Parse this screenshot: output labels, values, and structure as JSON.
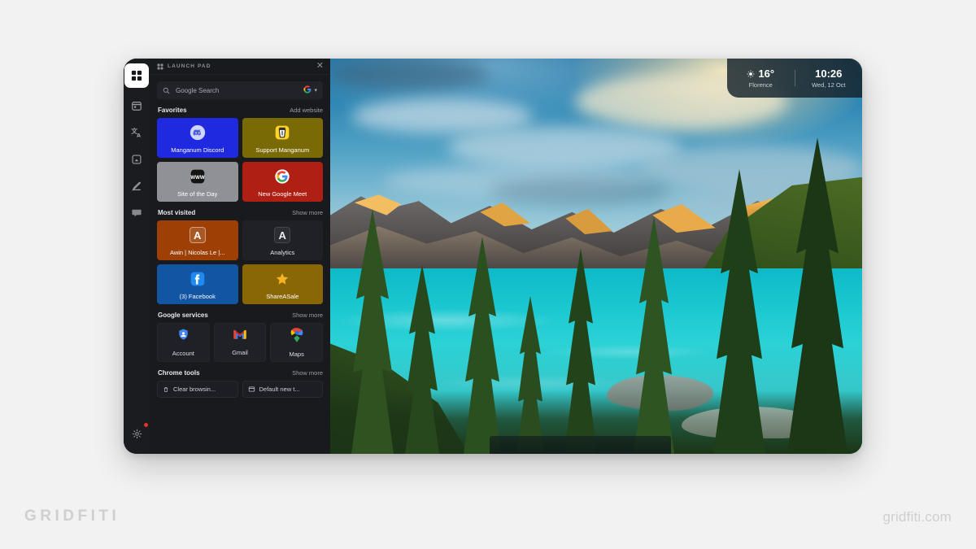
{
  "brand": {
    "left": "GRIDFITI",
    "right": "gridfiti.com"
  },
  "colors": {
    "panel_bg": "#191a1e",
    "rail_bg": "#1b1c20",
    "accent_red": "#e8322b",
    "tile_discord": "#1f2ae0",
    "tile_support": "#7a6a05",
    "tile_siteofday": "#8f9196",
    "tile_meet": "#b01f14",
    "tile_awin": "#9e4005",
    "tile_analytics": "#202127",
    "tile_facebook": "#1155a3",
    "tile_shareasale": "#8a6706"
  },
  "rail": {
    "items": [
      {
        "name": "launchpad",
        "icon": "grid-icon",
        "active": true
      },
      {
        "name": "calendar",
        "icon": "calendar-icon",
        "active": false
      },
      {
        "name": "translate",
        "icon": "translate-icon",
        "active": false
      },
      {
        "name": "screenshot",
        "icon": "screenshot-icon",
        "active": false
      },
      {
        "name": "notes",
        "icon": "edit-note-icon",
        "active": false
      },
      {
        "name": "chat",
        "icon": "chat-bubble-icon",
        "active": false
      }
    ],
    "settings": {
      "name": "settings",
      "icon": "gear-icon",
      "badge": true
    }
  },
  "panel": {
    "title": "LAUNCH PAD",
    "title_icon": "grid-icon",
    "close_label": "✕",
    "search": {
      "placeholder": "Google Search",
      "icon": "search-icon",
      "engine": "Google",
      "chevron": "▾"
    },
    "sections": [
      {
        "id": "favorites",
        "title": "Favorites",
        "action": "Add website",
        "layout": "tiles",
        "tiles": [
          {
            "label": "Manganum Discord",
            "color": "#1f2ae0",
            "icon": "discord-icon",
            "dark": false
          },
          {
            "label": "Support Manganum",
            "color": "#7a6a05",
            "icon": "tip-jar-icon",
            "dark": false
          },
          {
            "label": "Site of the Day",
            "color": "#8f9196",
            "icon": "www-icon",
            "dark": false
          },
          {
            "label": "New Google Meet",
            "color": "#b01f14",
            "icon": "google-icon",
            "dark": false
          }
        ]
      },
      {
        "id": "most-visited",
        "title": "Most visited",
        "action": "Show more",
        "layout": "tiles",
        "tiles": [
          {
            "label": "Awin | Nicolas Le |...",
            "color": "#9e4005",
            "icon": "letter-a-icon",
            "letter": "A",
            "dark": false
          },
          {
            "label": "Analytics",
            "color": "#202127",
            "icon": "letter-a-icon",
            "letter": "A",
            "dark": true
          },
          {
            "label": "(3) Facebook",
            "color": "#1155a3",
            "icon": "facebook-icon",
            "dark": false
          },
          {
            "label": "ShareASale",
            "color": "#8a6706",
            "icon": "star-icon",
            "dark": false
          }
        ]
      },
      {
        "id": "google-services",
        "title": "Google services",
        "action": "Show more",
        "layout": "services",
        "services": [
          {
            "label": "Account",
            "icon": "google-account-shield-icon"
          },
          {
            "label": "Gmail",
            "icon": "gmail-icon"
          },
          {
            "label": "Maps",
            "icon": "google-maps-pin-icon"
          }
        ]
      },
      {
        "id": "chrome-tools",
        "title": "Chrome tools",
        "action": "Show more",
        "layout": "tools",
        "tools": [
          {
            "label": "Clear browsin...",
            "icon": "trash-icon"
          },
          {
            "label": "Default new t...",
            "icon": "window-icon"
          }
        ]
      }
    ]
  },
  "widget": {
    "weather": {
      "icon": "sun-icon",
      "temperature": "16°",
      "location": "Florence"
    },
    "clock": {
      "time": "10:26",
      "date": "Wed, 12 Oct"
    }
  }
}
